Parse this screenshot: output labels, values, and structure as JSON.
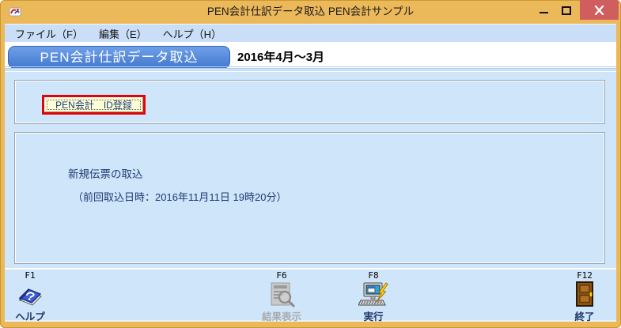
{
  "window": {
    "title": "PEN会計仕訳データ取込 PEN会計サンプル"
  },
  "menu": {
    "items": [
      {
        "label": "ファイル（F）"
      },
      {
        "label": "編集（E）"
      },
      {
        "label": "ヘルプ（H）"
      }
    ]
  },
  "header": {
    "app_title": "PEN会計仕訳データ取込",
    "period": "2016年4月～3月"
  },
  "id_panel": {
    "button_label": "PEN会計　ID登録"
  },
  "import_panel": {
    "line1": "新規伝票の取込",
    "line2": "（前回取込日時：2016年11月11日 19時20分）"
  },
  "toolbar": {
    "buttons": [
      {
        "fkey": "F1",
        "label": "ヘルプ",
        "icon": "help-book-icon",
        "enabled": true
      },
      {
        "fkey": "F6",
        "label": "結果表示",
        "icon": "results-magnifier-icon",
        "enabled": false
      },
      {
        "fkey": "F8",
        "label": "実行",
        "icon": "execute-computer-icon",
        "enabled": true
      },
      {
        "fkey": "F12",
        "label": "終了",
        "icon": "exit-door-icon",
        "enabled": true
      }
    ]
  },
  "icons": {
    "app": "pen-app-icon",
    "minimize": "minimize-icon",
    "maximize": "maximize-icon",
    "close": "close-x-icon"
  },
  "colors": {
    "titlebar": "#EBB85A",
    "close_button": "#D15E5E",
    "menu_bar": "#CADFF7",
    "screen_title_bg": "#4C88DC",
    "panel_bg": "#CFE5FA",
    "highlight_red": "#E30505",
    "button_bg": "#FFFFD6",
    "text_navy": "#1F3B73",
    "disabled_gray": "#A9ACB0"
  }
}
